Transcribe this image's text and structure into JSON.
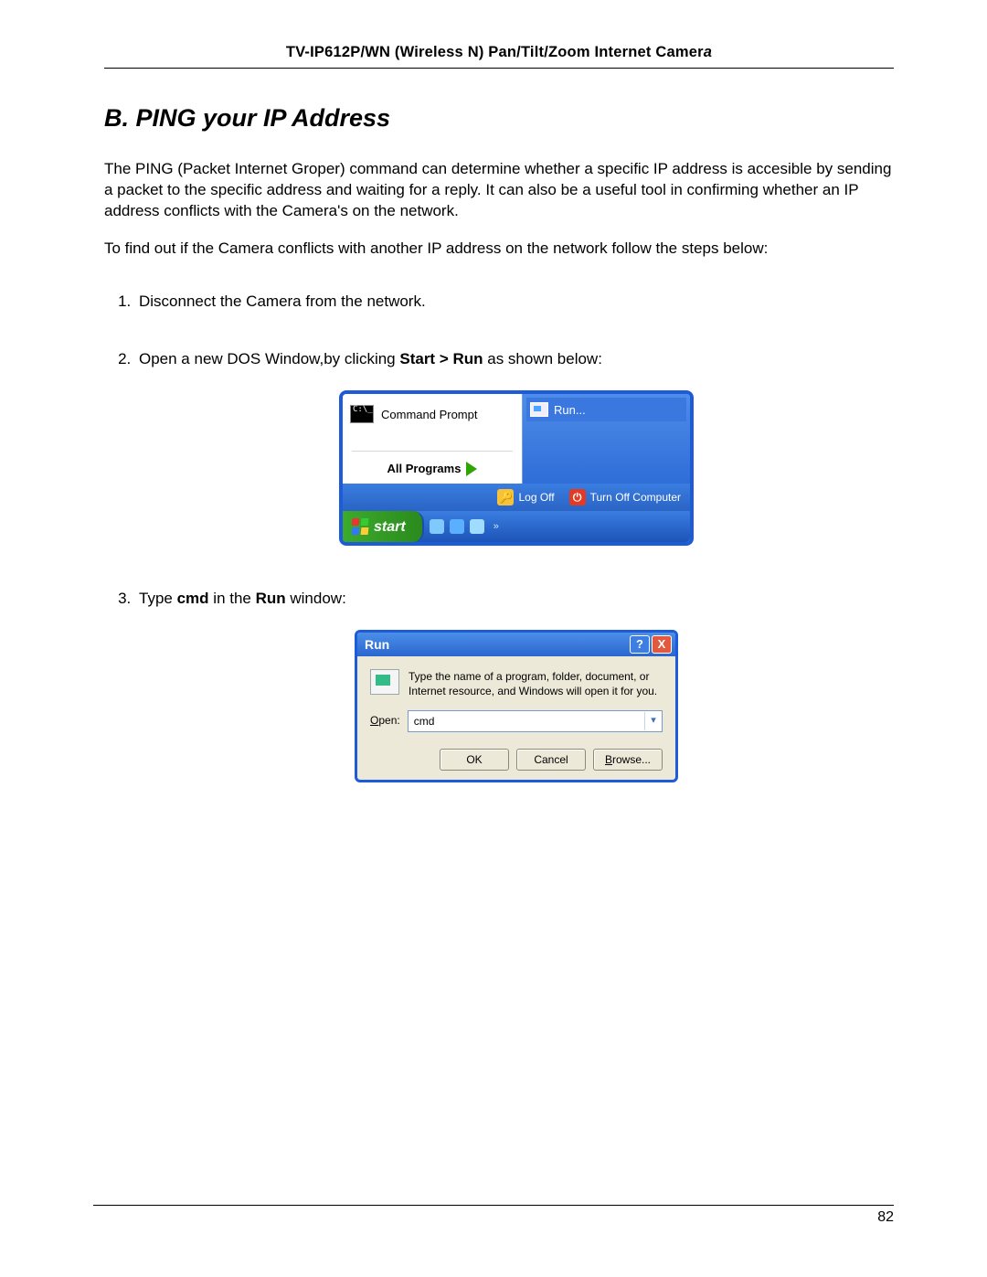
{
  "header": {
    "title_prefix": "TV-IP612P/WN (Wireless N) Pan/Tilt/Zoom Internet Camer",
    "title_italic": "a"
  },
  "section_heading": "B. PING your IP Address",
  "para1": "The PING (Packet Internet Groper) command can determine whether a specific IP address is accesible by sending a packet to the specific address and waiting for a reply. It can also be a useful tool in confirming whether an IP address conflicts with the Camera's on the network.",
  "para2": "To find out if the Camera conflicts with another IP address on the network follow the steps below:",
  "steps": {
    "s1": "Disconnect the Camera from the network.",
    "s2_a": "Open a new DOS Window,by clicking ",
    "s2_b": "Start > Run",
    "s2_c": " as shown below:",
    "s3_a": "Type ",
    "s3_b": "cmd",
    "s3_c": " in the ",
    "s3_d": "Run",
    "s3_e": " window:"
  },
  "startmenu": {
    "command_prompt": "Command Prompt",
    "all_programs": "All Programs",
    "run": "Run...",
    "log_off": "Log Off",
    "turn_off": "Turn Off Computer",
    "start": "start",
    "cmd_glyph": "C:\\_"
  },
  "run_dialog": {
    "title": "Run",
    "help_glyph": "?",
    "close_glyph": "X",
    "message": "Type the name of a program, folder, document, or Internet resource, and Windows will open it for you.",
    "open_label_u": "O",
    "open_label_rest": "pen:",
    "open_value": "cmd",
    "ok": "OK",
    "cancel": "Cancel",
    "browse_u": "B",
    "browse_rest": "rowse..."
  },
  "page_number": "82"
}
